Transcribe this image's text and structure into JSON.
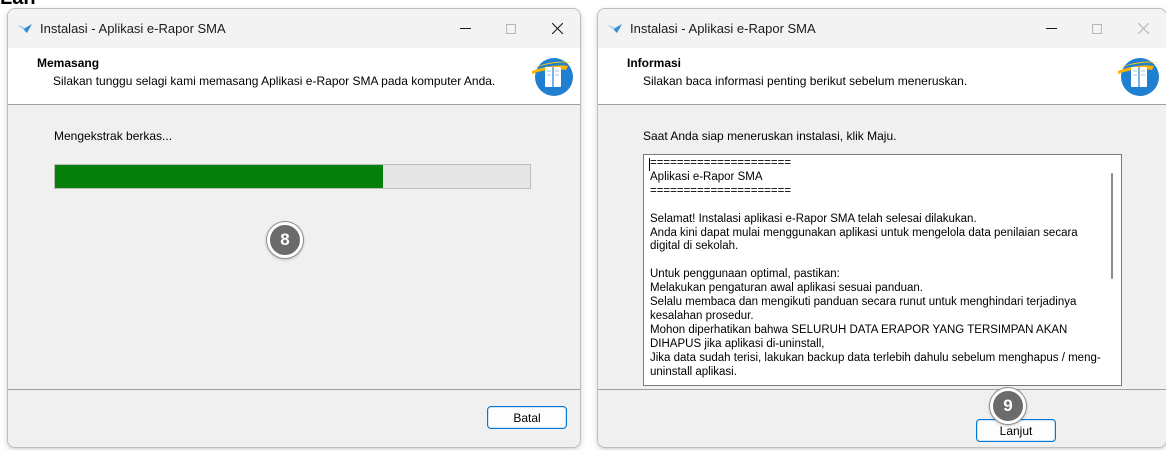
{
  "window_left": {
    "title": "Instalasi - Aplikasi e-Rapor SMA",
    "header_title": "Memasang",
    "header_subtitle": "Silakan tunggu selagi kami memasang Aplikasi e-Rapor SMA pada komputer Anda.",
    "status_text": "Mengekstrak berkas...",
    "progress_fraction": 0.69,
    "badge": "8",
    "cancel_label": "Batal"
  },
  "window_right": {
    "title": "Instalasi - Aplikasi e-Rapor SMA",
    "header_title": "Informasi",
    "header_subtitle": "Silakan baca informasi penting berikut sebelum meneruskan.",
    "prompt": "Saat Anda siap meneruskan instalasi, klik Maju.",
    "memo_text": "=====================\nAplikasi e-Rapor SMA\n=====================\n\nSelamat! Instalasi aplikasi e-Rapor SMA telah selesai dilakukan.\nAnda kini dapat mulai menggunakan aplikasi untuk mengelola data penilaian secara digital di sekolah.\n\nUntuk penggunaan optimal, pastikan:\nMelakukan pengaturan awal aplikasi sesuai panduan.\nSelalu membaca dan mengikuti panduan secara runut untuk menghindari terjadinya kesalahan prosedur.\nMohon diperhatikan bahwa SELURUH DATA ERAPOR YANG TERSIMPAN AKAN DIHAPUS jika aplikasi di-uninstall,\nJika data sudah terisi, lakukan backup data terlebih dahulu sebelum menghapus / meng-uninstall aplikasi.",
    "badge": "9",
    "next_label": "Lanjut"
  },
  "colors": {
    "progress_fill": "#06800a",
    "accent_border": "#0078d4",
    "badge_bg": "#6b6b6b"
  },
  "icons": [
    "app-icon",
    "minimize-icon",
    "maximize-icon",
    "close-icon",
    "book-logo-icon"
  ]
}
